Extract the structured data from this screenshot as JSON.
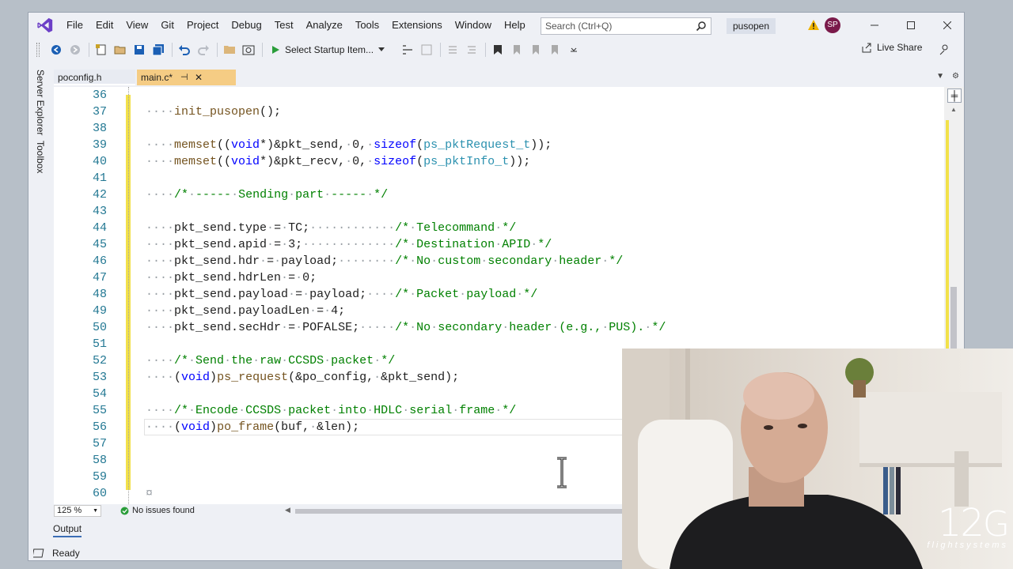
{
  "menu": [
    "File",
    "Edit",
    "View",
    "Git",
    "Project",
    "Debug",
    "Test",
    "Analyze",
    "Tools",
    "Extensions",
    "Window",
    "Help"
  ],
  "search": {
    "placeholder": "Search (Ctrl+Q)"
  },
  "solution_name": "pusopen",
  "user_initials": "SP",
  "toolbar": {
    "startup_label": "Select Startup Item...",
    "live_share_label": "Live Share"
  },
  "side_tabs": [
    "Server Explorer",
    "Toolbox"
  ],
  "tabs": [
    {
      "label": "poconfig.h",
      "active": false
    },
    {
      "label": "main.c*",
      "active": true
    }
  ],
  "editor": {
    "lines": [
      {
        "n": "36"
      },
      {
        "n": "37"
      },
      {
        "n": "38"
      },
      {
        "n": "39"
      },
      {
        "n": "40"
      },
      {
        "n": "41"
      },
      {
        "n": "42"
      },
      {
        "n": "43"
      },
      {
        "n": "44"
      },
      {
        "n": "45"
      },
      {
        "n": "46"
      },
      {
        "n": "47"
      },
      {
        "n": "48"
      },
      {
        "n": "49"
      },
      {
        "n": "50"
      },
      {
        "n": "51"
      },
      {
        "n": "52"
      },
      {
        "n": "53"
      },
      {
        "n": "54"
      },
      {
        "n": "55"
      },
      {
        "n": "56"
      },
      {
        "n": "57"
      },
      {
        "n": "58"
      },
      {
        "n": "59"
      },
      {
        "n": "60"
      }
    ]
  },
  "editor_status": {
    "zoom": "125 %",
    "issues": "No issues found"
  },
  "output_label": "Output",
  "status": {
    "text": "Ready"
  },
  "brand": {
    "number": "12",
    "sub": "flightsystems"
  },
  "colors": {
    "accent": "#f5cc84",
    "change_bar": "#f2e14a",
    "line_number": "#237893",
    "comment": "#008000",
    "keyword": "#0000ff"
  }
}
